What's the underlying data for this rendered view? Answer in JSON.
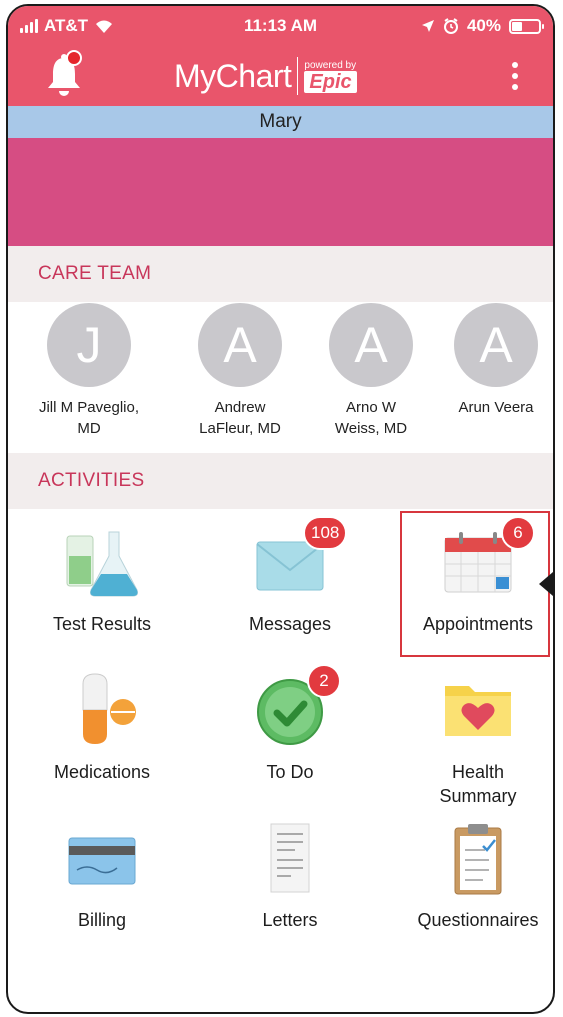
{
  "status": {
    "carrier": "AT&T",
    "time": "11:13 AM",
    "battery": "40%",
    "battery_level": 0.4
  },
  "header": {
    "logo_text": "MyChart",
    "powered_by": "powered by",
    "epic": "Epic",
    "notification_dot": true
  },
  "patient_name": "Mary",
  "care_team": {
    "title": "CARE TEAM",
    "members": [
      {
        "initial": "J",
        "name_line1": "Jill M Paveglio,",
        "name_line2": "MD"
      },
      {
        "initial": "A",
        "name_line1": "Andrew",
        "name_line2": "LaFleur, MD"
      },
      {
        "initial": "A",
        "name_line1": "Arno W",
        "name_line2": "Weiss, MD"
      },
      {
        "initial": "A",
        "name_line1": "Arun Veera",
        "name_line2": ""
      }
    ]
  },
  "activities": {
    "title": "ACTIVITIES",
    "items": [
      {
        "label_line1": "Test Results",
        "label_line2": "",
        "icon": "lab-beaker-icon",
        "badge": ""
      },
      {
        "label_line1": "Messages",
        "label_line2": "",
        "icon": "envelope-icon",
        "badge": "108"
      },
      {
        "label_line1": "Appointments",
        "label_line2": "",
        "icon": "calendar-icon",
        "badge": "6"
      },
      {
        "label_line1": "Medications",
        "label_line2": "",
        "icon": "pill-icon",
        "badge": ""
      },
      {
        "label_line1": "To Do",
        "label_line2": "",
        "icon": "checkmark-icon",
        "badge": "2"
      },
      {
        "label_line1": "Health",
        "label_line2": "Summary",
        "icon": "heart-folder-icon",
        "badge": ""
      },
      {
        "label_line1": "Billing",
        "label_line2": "",
        "icon": "credit-card-icon",
        "badge": ""
      },
      {
        "label_line1": "Letters",
        "label_line2": "",
        "icon": "letter-document-icon",
        "badge": ""
      },
      {
        "label_line1": "Questionnaires",
        "label_line2": "",
        "icon": "clipboard-icon",
        "badge": ""
      }
    ]
  },
  "colors": {
    "header": "#e9556b",
    "name_bar": "#a8c8e8",
    "banner": "#d64d83",
    "section_text": "#c8365a",
    "badge": "#e23a3f"
  }
}
